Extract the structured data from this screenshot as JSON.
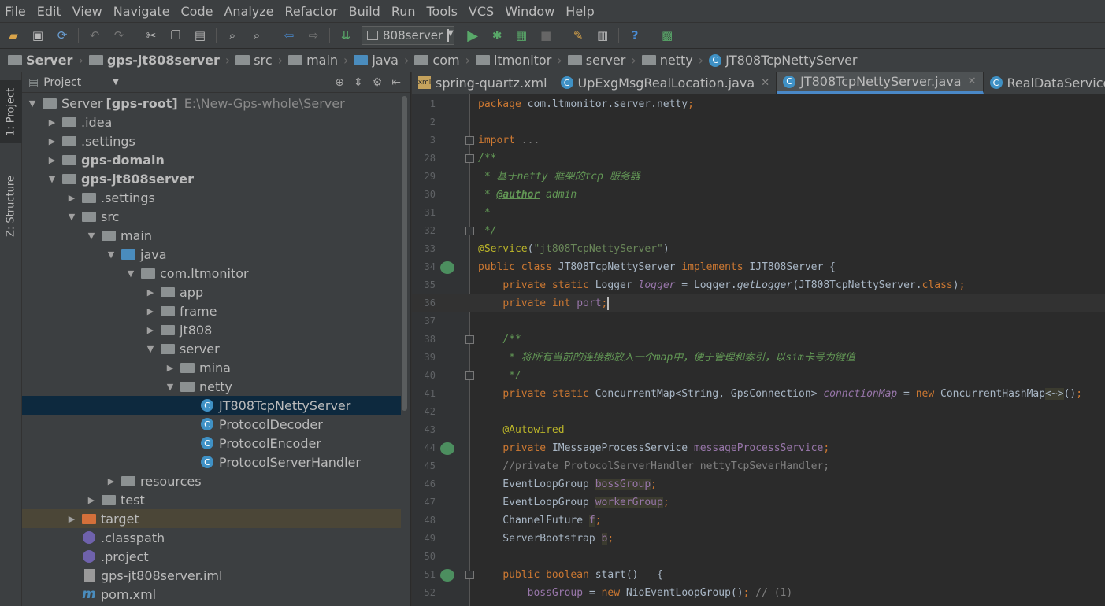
{
  "menu": [
    "File",
    "Edit",
    "View",
    "Navigate",
    "Code",
    "Analyze",
    "Refactor",
    "Build",
    "Run",
    "Tools",
    "VCS",
    "Window",
    "Help"
  ],
  "toolbar": {
    "run_config": "808server",
    "icons": [
      "open-icon",
      "save-icon",
      "sync-icon",
      "undo-icon",
      "redo-icon",
      "cut-icon",
      "copy-icon",
      "paste-icon",
      "find-icon",
      "replace-icon",
      "back-icon",
      "forward-icon",
      "make-icon",
      "run-icon",
      "debug-icon",
      "coverage-icon",
      "stop-icon",
      "settings-icon",
      "structure-icon",
      "help-icon",
      "sdk-icon"
    ]
  },
  "breadcrumbs": [
    "Server",
    "gps-jt808server",
    "src",
    "main",
    "java",
    "com",
    "ltmonitor",
    "server",
    "netty",
    "JT808TcpNettyServer"
  ],
  "side_tabs": {
    "project": "1: Project",
    "structure": "Z: Structure"
  },
  "project_panel": {
    "title": "Project",
    "tree": [
      {
        "label": "Server",
        "extra": "[gps-root]",
        "path": "E:\\New-Gps-whole\\Server",
        "depth": 0,
        "arrow": "down",
        "icon": "module"
      },
      {
        "label": ".idea",
        "depth": 1,
        "arrow": "right",
        "icon": "folder"
      },
      {
        "label": ".settings",
        "depth": 1,
        "arrow": "right",
        "icon": "folder"
      },
      {
        "label": "gps-domain",
        "depth": 1,
        "arrow": "right",
        "icon": "module",
        "bold": true
      },
      {
        "label": "gps-jt808server",
        "depth": 1,
        "arrow": "down",
        "icon": "module",
        "bold": true
      },
      {
        "label": ".settings",
        "depth": 2,
        "arrow": "right",
        "icon": "folder"
      },
      {
        "label": "src",
        "depth": 2,
        "arrow": "down",
        "icon": "folder"
      },
      {
        "label": "main",
        "depth": 3,
        "arrow": "down",
        "icon": "folder"
      },
      {
        "label": "java",
        "depth": 4,
        "arrow": "down",
        "icon": "folder-blue"
      },
      {
        "label": "com.ltmonitor",
        "depth": 5,
        "arrow": "down",
        "icon": "package"
      },
      {
        "label": "app",
        "depth": 6,
        "arrow": "right",
        "icon": "package"
      },
      {
        "label": "frame",
        "depth": 6,
        "arrow": "right",
        "icon": "package"
      },
      {
        "label": "jt808",
        "depth": 6,
        "arrow": "right",
        "icon": "package"
      },
      {
        "label": "server",
        "depth": 6,
        "arrow": "down",
        "icon": "package"
      },
      {
        "label": "mina",
        "depth": 7,
        "arrow": "right",
        "icon": "package"
      },
      {
        "label": "netty",
        "depth": 7,
        "arrow": "down",
        "icon": "package"
      },
      {
        "label": "JT808TcpNettyServer",
        "depth": 8,
        "arrow": "none",
        "icon": "class",
        "selected": true
      },
      {
        "label": "ProtocolDecoder",
        "depth": 8,
        "arrow": "none",
        "icon": "class"
      },
      {
        "label": "ProtocolEncoder",
        "depth": 8,
        "arrow": "none",
        "icon": "class"
      },
      {
        "label": "ProtocolServerHandler",
        "depth": 8,
        "arrow": "none",
        "icon": "class"
      },
      {
        "label": "resources",
        "depth": 4,
        "arrow": "right",
        "icon": "folder-res"
      },
      {
        "label": "test",
        "depth": 3,
        "arrow": "right",
        "icon": "folder"
      },
      {
        "label": "target",
        "depth": 2,
        "arrow": "right",
        "icon": "folder-orange",
        "excluded": true
      },
      {
        "label": ".classpath",
        "depth": 2,
        "arrow": "none",
        "icon": "eclipse"
      },
      {
        "label": ".project",
        "depth": 2,
        "arrow": "none",
        "icon": "eclipse"
      },
      {
        "label": "gps-jt808server.iml",
        "depth": 2,
        "arrow": "none",
        "icon": "iml"
      },
      {
        "label": "pom.xml",
        "depth": 2,
        "arrow": "none",
        "icon": "maven"
      }
    ]
  },
  "editor": {
    "tabs": [
      {
        "label": "spring-quartz.xml",
        "icon": "xml",
        "active": false,
        "closable": false
      },
      {
        "label": "UpExgMsgRealLocation.java",
        "icon": "class",
        "active": false,
        "closable": true
      },
      {
        "label": "JT808TcpNettyServer.java",
        "icon": "class",
        "active": true,
        "closable": true
      },
      {
        "label": "RealDataService.java",
        "icon": "class",
        "active": false,
        "closable": false
      }
    ],
    "lines": [
      {
        "n": "1",
        "t": [
          [
            "kw",
            "package "
          ],
          [
            "",
            "com.ltmonitor.server.netty"
          ],
          [
            "kw",
            ";"
          ]
        ]
      },
      {
        "n": "2",
        "t": []
      },
      {
        "n": "3",
        "fold": true,
        "t": [
          [
            "kw",
            "import "
          ],
          [
            "cmt",
            "..."
          ]
        ]
      },
      {
        "n": "28",
        "fold": true,
        "t": [
          [
            "doc",
            "/**"
          ]
        ]
      },
      {
        "n": "29",
        "t": [
          [
            "doc",
            " * 基于netty 框架的tcp 服务器"
          ]
        ]
      },
      {
        "n": "30",
        "t": [
          [
            "doc",
            " * "
          ],
          [
            "doctag",
            "@author"
          ],
          [
            "doc",
            " admin"
          ]
        ]
      },
      {
        "n": "31",
        "t": [
          [
            "doc",
            " *"
          ]
        ]
      },
      {
        "n": "32",
        "fold": true,
        "t": [
          [
            "doc",
            " */"
          ]
        ]
      },
      {
        "n": "33",
        "t": [
          [
            "ann",
            "@Service"
          ],
          [
            "",
            "("
          ],
          [
            "str",
            "\"jt808TcpNettyServer\""
          ],
          [
            "",
            ")"
          ]
        ]
      },
      {
        "n": "34",
        "gutter": true,
        "t": [
          [
            "kw",
            "public class "
          ],
          [
            "",
            "JT808TcpNettyServer "
          ],
          [
            "kw",
            "implements "
          ],
          [
            "",
            "IJT808Server {"
          ]
        ]
      },
      {
        "n": "35",
        "t": [
          [
            "",
            "    "
          ],
          [
            "kw",
            "private static "
          ],
          [
            "",
            "Logger "
          ],
          [
            "sfld",
            "logger"
          ],
          [
            "",
            " = Logger."
          ],
          [
            "smeth",
            "getLogger"
          ],
          [
            "",
            "(JT808TcpNettyServer."
          ],
          [
            "kw",
            "class"
          ],
          [
            "",
            ")"
          ],
          [
            "kw",
            ";"
          ]
        ]
      },
      {
        "n": "36",
        "current": true,
        "t": [
          [
            "",
            "    "
          ],
          [
            "kw",
            "private int "
          ],
          [
            "fld",
            "port"
          ],
          [
            "kw",
            ";"
          ],
          [
            "caret",
            ""
          ]
        ]
      },
      {
        "n": "37",
        "t": []
      },
      {
        "n": "38",
        "fold": true,
        "t": [
          [
            "",
            "    "
          ],
          [
            "doc",
            "/**"
          ]
        ]
      },
      {
        "n": "39",
        "t": [
          [
            "",
            "    "
          ],
          [
            "doc",
            " * 将所有当前的连接都放入一个map中，便于管理和索引，以sim卡号为键值"
          ]
        ]
      },
      {
        "n": "40",
        "fold": true,
        "t": [
          [
            "",
            "    "
          ],
          [
            "doc",
            " */"
          ]
        ]
      },
      {
        "n": "41",
        "t": [
          [
            "",
            "    "
          ],
          [
            "kw",
            "private static "
          ],
          [
            "",
            "ConcurrentMap<String, GpsConnection> "
          ],
          [
            "sfld",
            "connctionMap"
          ],
          [
            "",
            " = "
          ],
          [
            "kw",
            "new "
          ],
          [
            "",
            "ConcurrentHashMap"
          ],
          [
            "hl",
            "<~>"
          ],
          [
            "",
            "()"
          ],
          [
            "kw",
            ";"
          ]
        ]
      },
      {
        "n": "42",
        "t": []
      },
      {
        "n": "43",
        "t": [
          [
            "",
            "    "
          ],
          [
            "ann",
            "@Autowired"
          ]
        ]
      },
      {
        "n": "44",
        "gutter": true,
        "t": [
          [
            "",
            "    "
          ],
          [
            "kw",
            "private "
          ],
          [
            "",
            "IMessageProcessService "
          ],
          [
            "fld",
            "messageProcessService"
          ],
          [
            "kw",
            ";"
          ]
        ]
      },
      {
        "n": "45",
        "t": [
          [
            "",
            "    "
          ],
          [
            "cmt",
            "//private ProtocolServerHandler nettyTcpSeverHandler;"
          ]
        ]
      },
      {
        "n": "46",
        "t": [
          [
            "",
            "    EventLoopGroup "
          ],
          [
            "unused",
            "bossGroup"
          ],
          [
            "kw",
            ";"
          ]
        ]
      },
      {
        "n": "47",
        "t": [
          [
            "",
            "    EventLoopGroup "
          ],
          [
            "unused",
            "workerGroup"
          ],
          [
            "kw",
            ";"
          ]
        ]
      },
      {
        "n": "48",
        "t": [
          [
            "",
            "    ChannelFuture "
          ],
          [
            "unused",
            "f"
          ],
          [
            "kw",
            ";"
          ]
        ]
      },
      {
        "n": "49",
        "t": [
          [
            "",
            "    ServerBootstrap "
          ],
          [
            "unused",
            "b"
          ],
          [
            "kw",
            ";"
          ]
        ]
      },
      {
        "n": "50",
        "t": []
      },
      {
        "n": "51",
        "fold": true,
        "gutter": true,
        "t": [
          [
            "",
            "    "
          ],
          [
            "kw",
            "public boolean "
          ],
          [
            "",
            "start()   {"
          ]
        ]
      },
      {
        "n": "52",
        "t": [
          [
            "",
            "        "
          ],
          [
            "fld",
            "bossGroup"
          ],
          [
            "",
            " = "
          ],
          [
            "kw",
            "new "
          ],
          [
            "",
            "NioEventLoopGroup()"
          ],
          [
            "kw",
            "; "
          ],
          [
            "cmt",
            "// (1)"
          ]
        ]
      }
    ]
  },
  "colors": {
    "background": "#2b2b2b",
    "panel": "#3c3f41",
    "selection": "#0d293e",
    "accent": "#4a88c7"
  }
}
